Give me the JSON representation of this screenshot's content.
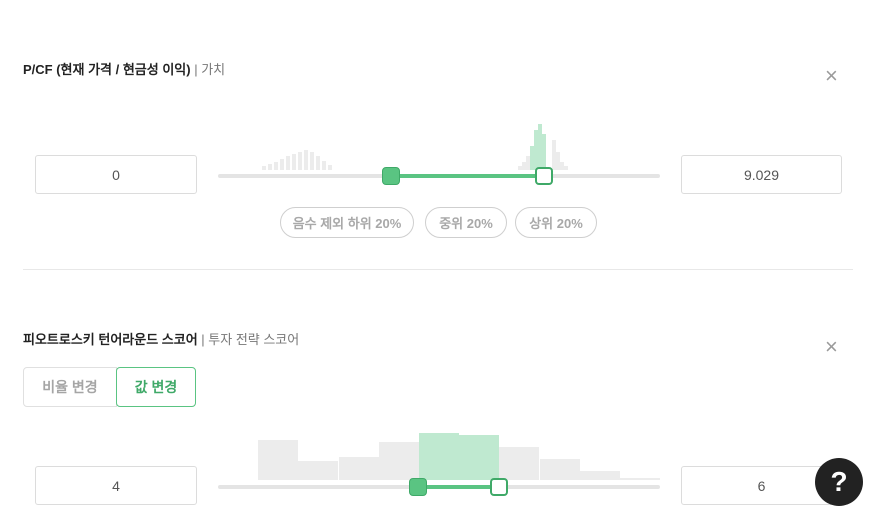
{
  "filters": [
    {
      "title": "P/CF (현재 가격 / 현금성 이익)",
      "subtitle": "| 가치",
      "close_icon": "×",
      "min_value": "0",
      "max_value": "9.029",
      "presets": [
        "음수 제외 하위 20%",
        "중위 20%",
        "상위 20%"
      ]
    },
    {
      "title": "피오트로스키 턴어라운드 스코어",
      "subtitle": "| 투자 전략 스코어",
      "close_icon": "×",
      "mode_tabs": [
        "비율 변경",
        "값 변경"
      ],
      "active_tab": "값 변경",
      "min_value": "4",
      "max_value": "6"
    }
  ],
  "help_button": "?",
  "colors": {
    "accent": "#5ac482",
    "accent_dark": "#3fa968",
    "histogram_bar": "#e8e8e8",
    "histogram_selected": "#bfe9d0"
  }
}
